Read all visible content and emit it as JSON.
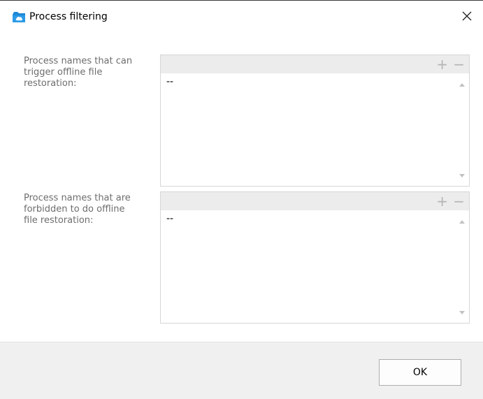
{
  "window": {
    "title": "Process filtering",
    "icon": "cloud-folder-icon",
    "close_icon": "close-icon"
  },
  "sections": [
    {
      "label": "Process names that can\ntrigger offline file\nrestoration:",
      "items": [
        "--"
      ],
      "add_icon": "plus-icon",
      "remove_icon": "minus-icon"
    },
    {
      "label": "Process names that are\nforbidden to do offline\nfile restoration:",
      "items": [
        "--"
      ],
      "add_icon": "plus-icon",
      "remove_icon": "minus-icon"
    }
  ],
  "footer": {
    "ok_label": "OK"
  },
  "colors": {
    "accent": "#1e88d6",
    "label_text": "#6d6d6d",
    "header_fill": "#ececec",
    "footer_fill": "#f0f0f0"
  }
}
